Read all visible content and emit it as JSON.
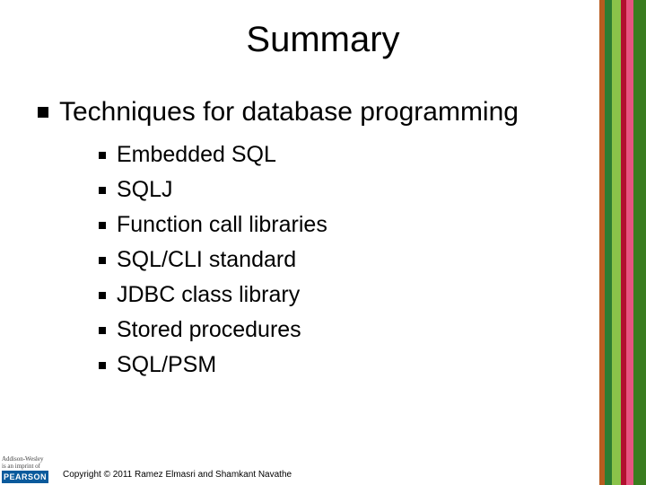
{
  "title": "Summary",
  "main_bullet": "Techniques for database programming",
  "sub_bullets": [
    "Embedded SQL",
    "SQLJ",
    "Function call libraries",
    "SQL/CLI standard",
    "JDBC class library",
    "Stored procedures",
    "SQL/PSM"
  ],
  "logo": {
    "line1": "Addison-Wesley",
    "line2": "is an imprint of",
    "brand": "PEARSON"
  },
  "copyright": "Copyright © 2011 Ramez Elmasri and Shamkant Navathe"
}
